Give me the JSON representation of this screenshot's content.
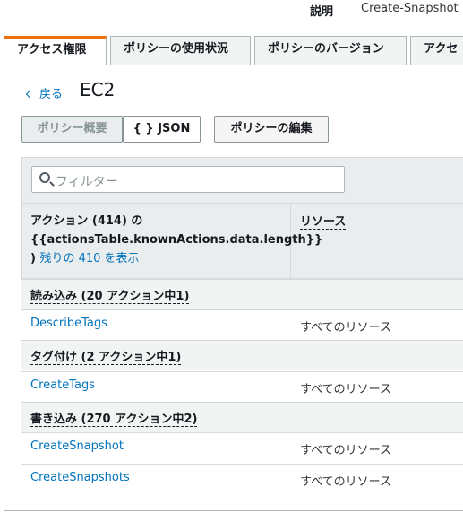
{
  "description": {
    "label": "説明",
    "value": "Create-Snapshot"
  },
  "tabs": [
    {
      "label": "アクセス権限"
    },
    {
      "label": "ポリシーの使用状況"
    },
    {
      "label": "ポリシーのバージョン"
    },
    {
      "label": "アクセ"
    }
  ],
  "nav": {
    "back_label": "戻る",
    "title": "EC2"
  },
  "buttons": {
    "summary": "ポリシー概要",
    "json": "{ } JSON",
    "edit": "ポリシーの編集"
  },
  "filter": {
    "placeholder": "フィルター"
  },
  "table": {
    "header_action_line1": "アクション (414) の",
    "header_action_line2": "{{actionsTable.knownActions.data.length}}",
    "header_action_line3": ")",
    "header_action_link": "残りの 410 を表示",
    "header_resource": "リソース",
    "rows": [
      {
        "label": "読み込み (20 アクション中1)"
      },
      {
        "label": "DescribeTags",
        "resource": "すべてのリソース"
      },
      {
        "label": "タグ付け (2 アクション中1)"
      },
      {
        "label": "CreateTags",
        "resource": "すべてのリソース"
      },
      {
        "label": "書き込み (270 アクション中2)"
      },
      {
        "label": "CreateSnapshot",
        "resource": "すべてのリソース"
      },
      {
        "label": "CreateSnapshots",
        "resource": "すべてのリソース"
      }
    ]
  }
}
